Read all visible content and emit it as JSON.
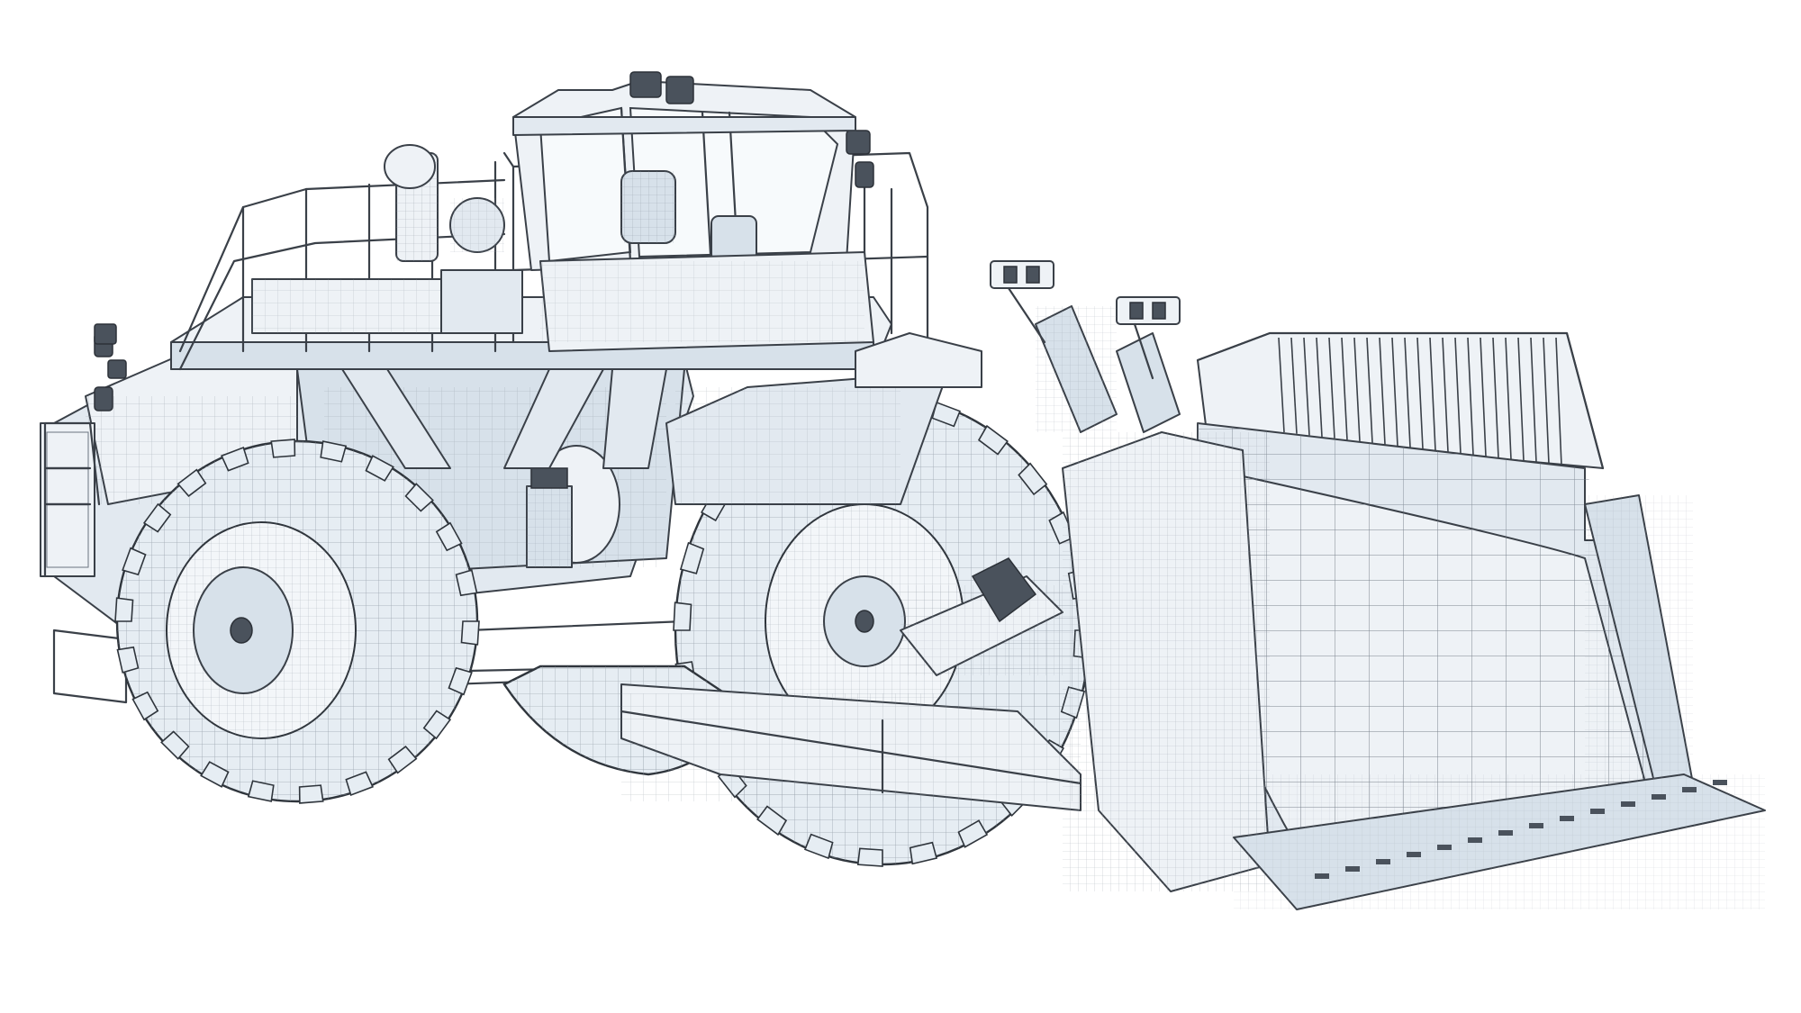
{
  "image": {
    "subject": "wireframe-render-wheel-loader",
    "palette": {
      "background": "#ffffff",
      "line": "#3a4048",
      "mesh": "#7d8692",
      "surface": "#eef2f6",
      "shade": "#d7e1ea"
    }
  }
}
